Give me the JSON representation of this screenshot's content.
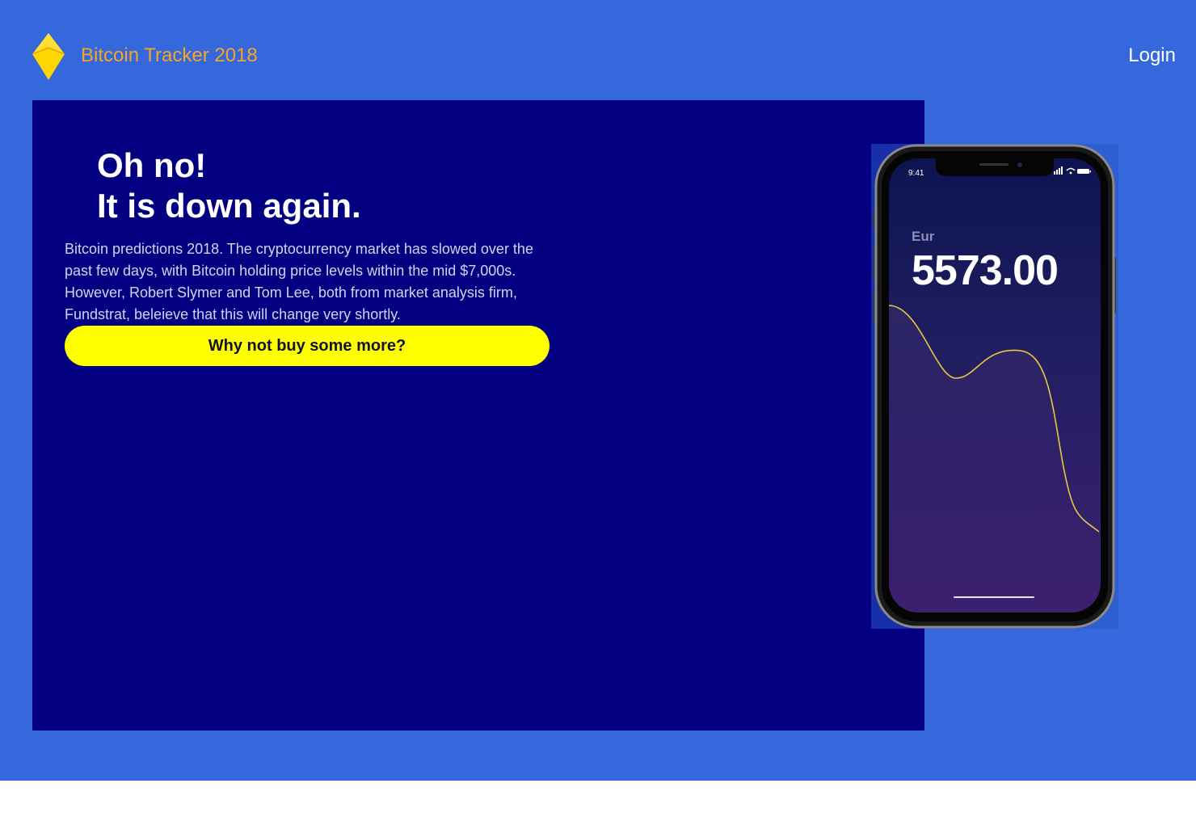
{
  "header": {
    "brand": "Bitcoin Tracker 2018",
    "login_label": "Login",
    "logo_icon": "diamond-logo-icon"
  },
  "hero": {
    "headline_line1": "Oh no!",
    "headline_line2": "It is down again.",
    "body": "Bitcoin predictions 2018. The cryptocurrency market has slowed over the past few days, with Bitcoin holding price levels within the mid $7,000s. However, Robert Slymer and Tom Lee, both from market analysis firm, Fundstrat, beleieve that this will change very shortly.",
    "cta_label": "Why not buy some more?"
  },
  "phone": {
    "time": "9:41",
    "currency": "Eur",
    "price": "5573.00"
  },
  "colors": {
    "page_bg": "#3468dc",
    "hero_bg": "#020080",
    "brand": "#f5a623",
    "cta": "#ffff00"
  }
}
